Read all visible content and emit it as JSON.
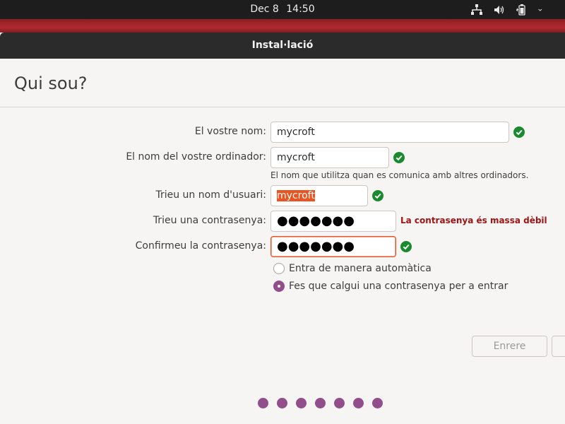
{
  "topbar": {
    "date": "Dec 8",
    "time": "14:50",
    "icons": [
      "network-icon",
      "volume-icon",
      "battery-icon",
      "system-menu-chevron-icon"
    ]
  },
  "window": {
    "title": "Instal·lació"
  },
  "page": {
    "title": "Qui sou?"
  },
  "form": {
    "name": {
      "label": "El vostre nom:",
      "value": "mycroft"
    },
    "computer": {
      "label": "El nom del vostre ordinador:",
      "value": "mycroft",
      "hint": "El nom que utilitza quan es comunica amb altres ordinadors."
    },
    "username": {
      "label": "Trieu un nom d'usuari:",
      "value": "mycroft"
    },
    "password": {
      "label": "Trieu una contrasenya:",
      "value": "●●●●●●●",
      "warning": "La contrasenya és massa dèbil"
    },
    "confirm": {
      "label": "Confirmeu la contrasenya:",
      "value": "●●●●●●●"
    },
    "login_options": [
      {
        "label": "Entra de manera automàtica",
        "selected": false
      },
      {
        "label": "Fes que calgui una contrasenya per a entrar",
        "selected": true
      }
    ]
  },
  "buttons": {
    "back": "Enrere"
  },
  "progress": {
    "steps": 7,
    "current_color": "#924d8b"
  },
  "colors": {
    "accent": "#e95420",
    "valid": "#1a8a2f",
    "error": "#a01414",
    "purple": "#924d8b"
  }
}
